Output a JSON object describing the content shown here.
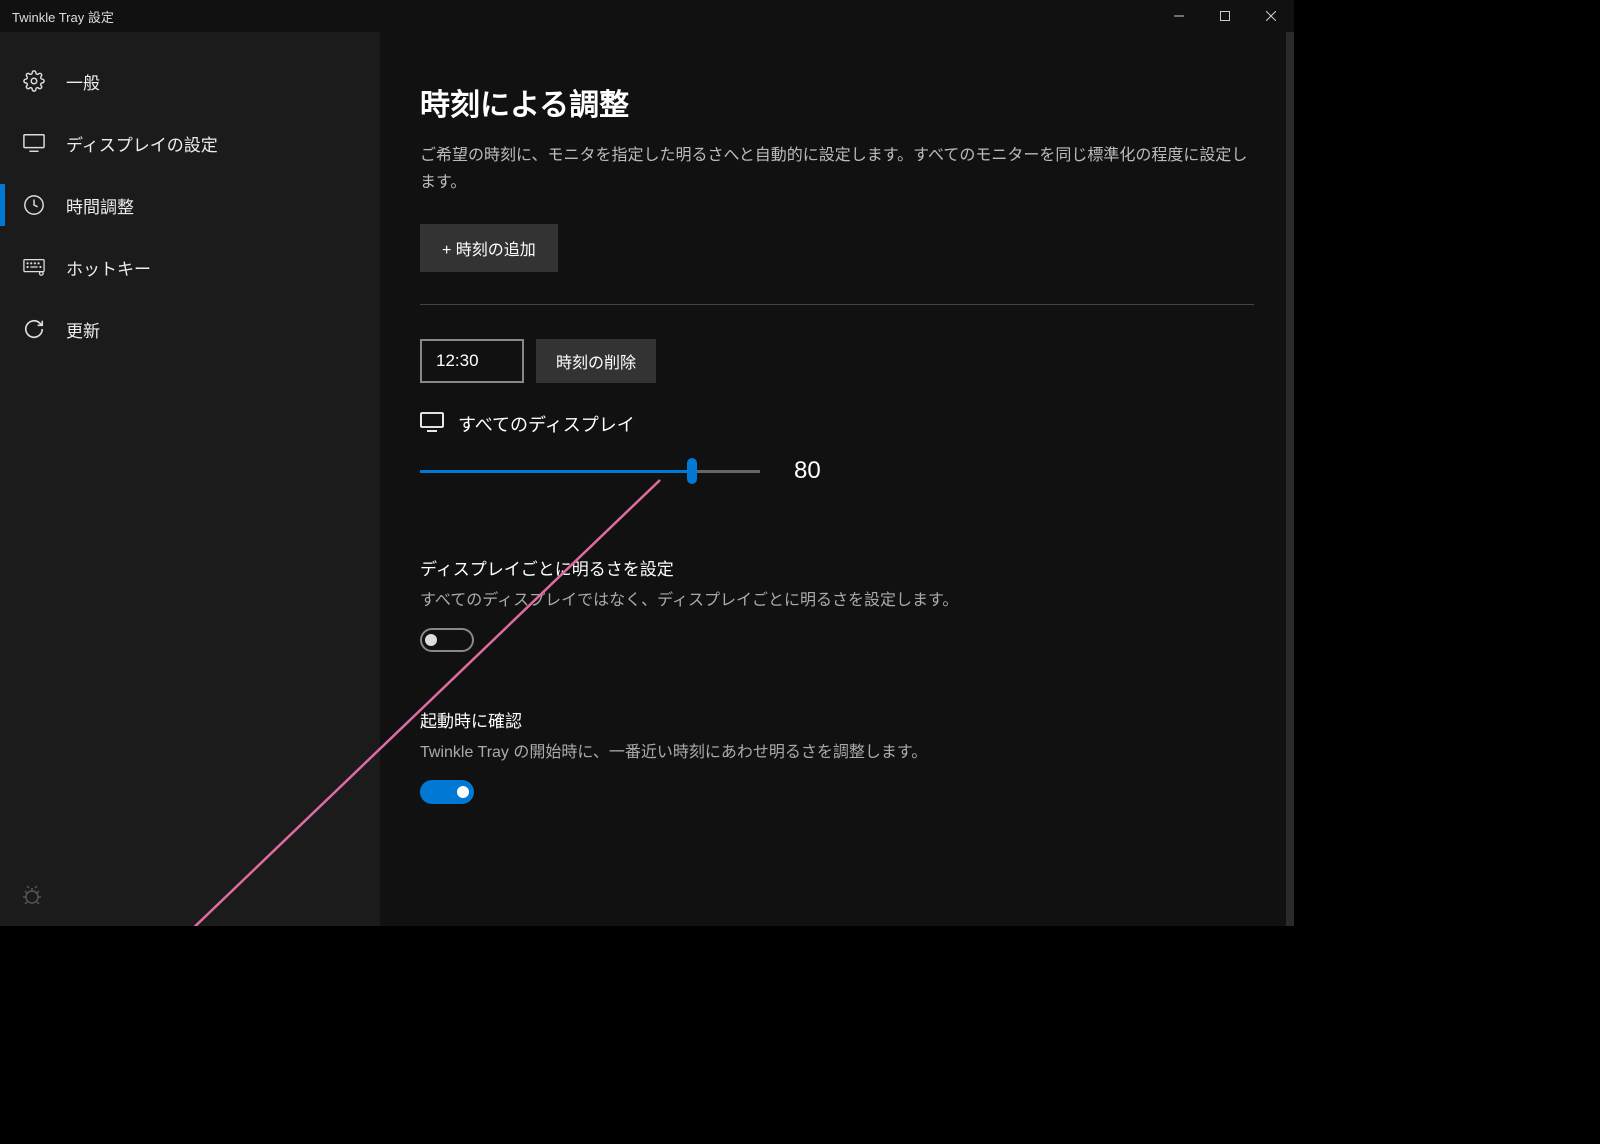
{
  "titlebar": {
    "title": "Twinkle Tray 設定"
  },
  "sidebar": {
    "items": [
      {
        "label": "一般",
        "icon": "gear"
      },
      {
        "label": "ディスプレイの設定",
        "icon": "display"
      },
      {
        "label": "時間調整",
        "icon": "clock",
        "active": true
      },
      {
        "label": "ホットキー",
        "icon": "keyboard"
      },
      {
        "label": "更新",
        "icon": "refresh"
      }
    ]
  },
  "main": {
    "heading": "時刻による調整",
    "description": "ご希望の時刻に、モニタを指定した明るさへと自動的に設定します。すべてのモニターを同じ標準化の程度に設定します。",
    "add_button": "+ 時刻の追加",
    "entry": {
      "time": "12:30",
      "delete_label": "時刻の削除",
      "display_label": "すべてのディスプレイ",
      "brightness_value": 80
    },
    "per_display": {
      "title": "ディスプレイごとに明るさを設定",
      "desc": "すべてのディスプレイではなく、ディスプレイごとに明るさを設定します。",
      "enabled": false
    },
    "startup_check": {
      "title": "起動時に確認",
      "desc": "Twinkle Tray の開始時に、一番近い時刻にあわせ明るさを調整します。",
      "enabled": true
    }
  },
  "colors": {
    "accent": "#0078d4",
    "annotation": "#e06ba4"
  }
}
